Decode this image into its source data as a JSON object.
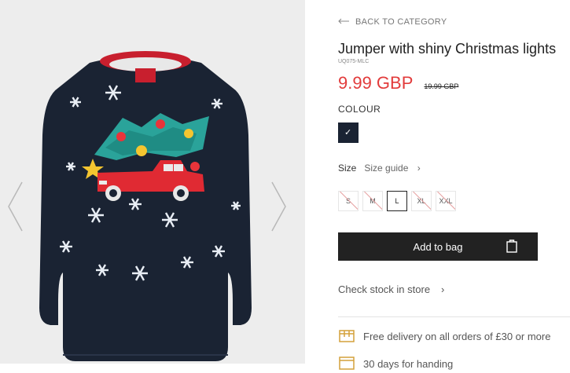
{
  "navigation": {
    "back_label": "BACK TO CATEGORY"
  },
  "product": {
    "title": "Jumper with shiny Christmas lights",
    "sku": "UQ075-MLC",
    "price_now": "9.99 GBP",
    "price_was": "19.99 GBP",
    "colour_label": "COLOUR",
    "selected_colour_mark": "✓",
    "size_label": "Size",
    "size_guide_label": "Size guide",
    "sizes": [
      {
        "label": "S",
        "available": false,
        "selected": false
      },
      {
        "label": "M",
        "available": false,
        "selected": false
      },
      {
        "label": "L",
        "available": true,
        "selected": true
      },
      {
        "label": "XL",
        "available": false,
        "selected": false
      },
      {
        "label": "XXL",
        "available": false,
        "selected": false
      }
    ],
    "add_to_bag_label": "Add to bag",
    "check_stock_label": "Check stock in store",
    "delivery_text": "Free delivery on all orders of £30 or more",
    "returns_text": "30 days for handing"
  },
  "gallery": {
    "image_name": "christmas-car-jumper",
    "background": "#ededed"
  },
  "colors": {
    "price_accent": "#e23b3b",
    "primary_button": "#222222",
    "jumper": "#1a2333",
    "icon_accent": "#d4a13a"
  }
}
